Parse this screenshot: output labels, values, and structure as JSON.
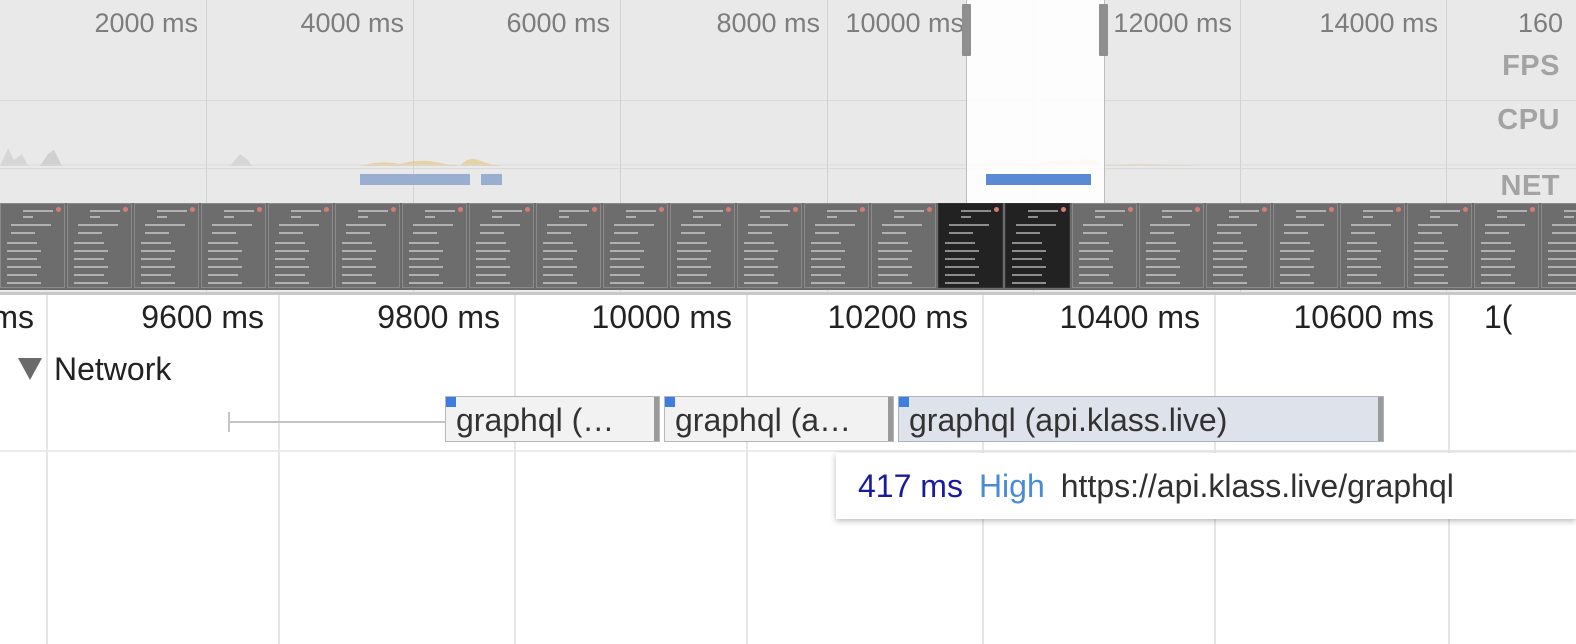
{
  "overview": {
    "ticks": [
      "2000 ms",
      "4000 ms",
      "6000 ms",
      "8000 ms",
      "10000 ms",
      "12000 ms",
      "14000 ms",
      "160"
    ],
    "tracks": [
      "FPS",
      "CPU",
      "NET"
    ],
    "window_label": "10000 ms"
  },
  "timeline": {
    "ticks": [
      "ms",
      "9600 ms",
      "9800 ms",
      "10000 ms",
      "10200 ms",
      "10400 ms",
      "10600 ms",
      "1("
    ],
    "network_label": "Network",
    "requests": [
      {
        "label": "graphql (…"
      },
      {
        "label": "graphql (a…"
      },
      {
        "label": "graphql (api.klass.live)"
      }
    ]
  },
  "tooltip": {
    "duration": "417 ms",
    "priority": "High",
    "url": "https://api.klass.live/graphql"
  },
  "colors": {
    "net_bar": "#9aaed0",
    "net_bar_selected": "#5a8ad6",
    "request_corner": "#3d7ee0",
    "cpu_activity": "#e2c37a"
  }
}
